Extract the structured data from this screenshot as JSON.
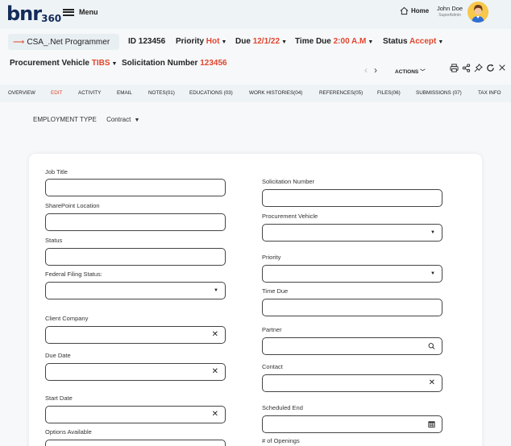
{
  "header": {
    "logo_main": "bnr",
    "logo_sub": "360",
    "menu_label": "Menu",
    "home_label": "Home",
    "user_name": "John Doe",
    "user_role": "SuperAdmin"
  },
  "summary": {
    "title": "CSA_.Net Programmer",
    "id_label": "ID",
    "id_value": "123456",
    "priority_label": "Priority",
    "priority_value": "Hot",
    "due_label": "Due",
    "due_value": "12/1/22",
    "time_due_label": "Time Due",
    "time_due_value": "2:00 A.M",
    "status_label": "Status",
    "status_value": "Accept",
    "procurement_label": "Procurement Vehicle",
    "procurement_value": "TIBS",
    "solicitation_label": "Solicitation Number",
    "solicitation_value": "123456",
    "actions_label": "ACTIONS"
  },
  "tabs": [
    {
      "label": "OVERVIEW"
    },
    {
      "label": "EDIT"
    },
    {
      "label": "ACTIVITY"
    },
    {
      "label": "EMAIL"
    },
    {
      "label": "NOTES(01)"
    },
    {
      "label": "EDUCATIONS (03)"
    },
    {
      "label": "WORK HISTORIES(04)"
    },
    {
      "label": "REFERENCES(05)"
    },
    {
      "label": "FILES(06)"
    },
    {
      "label": "SUBMISSIONS (07)"
    },
    {
      "label": "TAX INFO"
    }
  ],
  "employment": {
    "label": "EMPLOYMENT TYPE",
    "value": "Contract"
  },
  "form": {
    "left": [
      {
        "label": "Job Title",
        "value": ""
      },
      {
        "label": "SharePoint Location",
        "value": ""
      },
      {
        "label": "Status",
        "value": ""
      },
      {
        "label": "Federal Filing Status:",
        "value": ""
      },
      {
        "label": "Client Company",
        "value": ""
      },
      {
        "label": "Due Date",
        "value": ""
      },
      {
        "label": "Start Date",
        "value": ""
      },
      {
        "label": "Options Available",
        "value": ""
      }
    ],
    "right": [
      {
        "label": "Solicitation Number",
        "value": ""
      },
      {
        "label": "Procurement Vehicle",
        "value": ""
      },
      {
        "label": "Priority",
        "value": ""
      },
      {
        "label": "Time Due",
        "value": ""
      },
      {
        "label": "Partner",
        "value": ""
      },
      {
        "label": "Contact",
        "value": ""
      },
      {
        "label": "Scheduled End",
        "value": ""
      },
      {
        "label": "# of Openings",
        "value": ""
      }
    ]
  },
  "colors": {
    "accent": "#e0462d",
    "navy": "#142b5a",
    "bar_bg": "#eef3f6"
  }
}
